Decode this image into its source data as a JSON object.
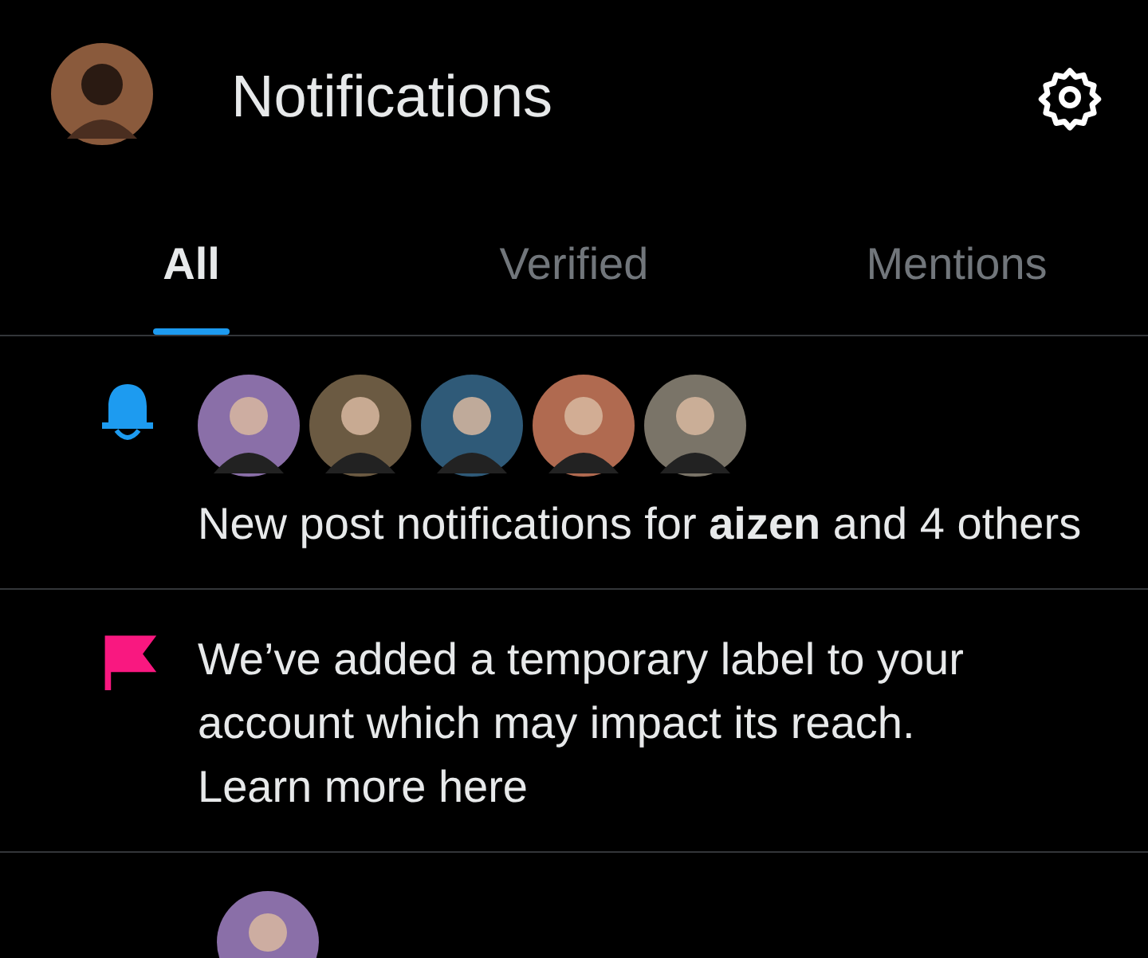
{
  "header": {
    "title": "Notifications"
  },
  "tabs": [
    {
      "label": "All",
      "selected": true
    },
    {
      "label": "Verified",
      "selected": false
    },
    {
      "label": "Mentions",
      "selected": false
    }
  ],
  "notifications": [
    {
      "kind": "bell",
      "text": "New post notifications for **aizen** and 4 others"
    },
    {
      "kind": "flag",
      "text": "We’ve added a temporary label to your account which may impact its reach.",
      "link": "Learn more here"
    },
    {
      "kind": "partial"
    }
  ]
}
